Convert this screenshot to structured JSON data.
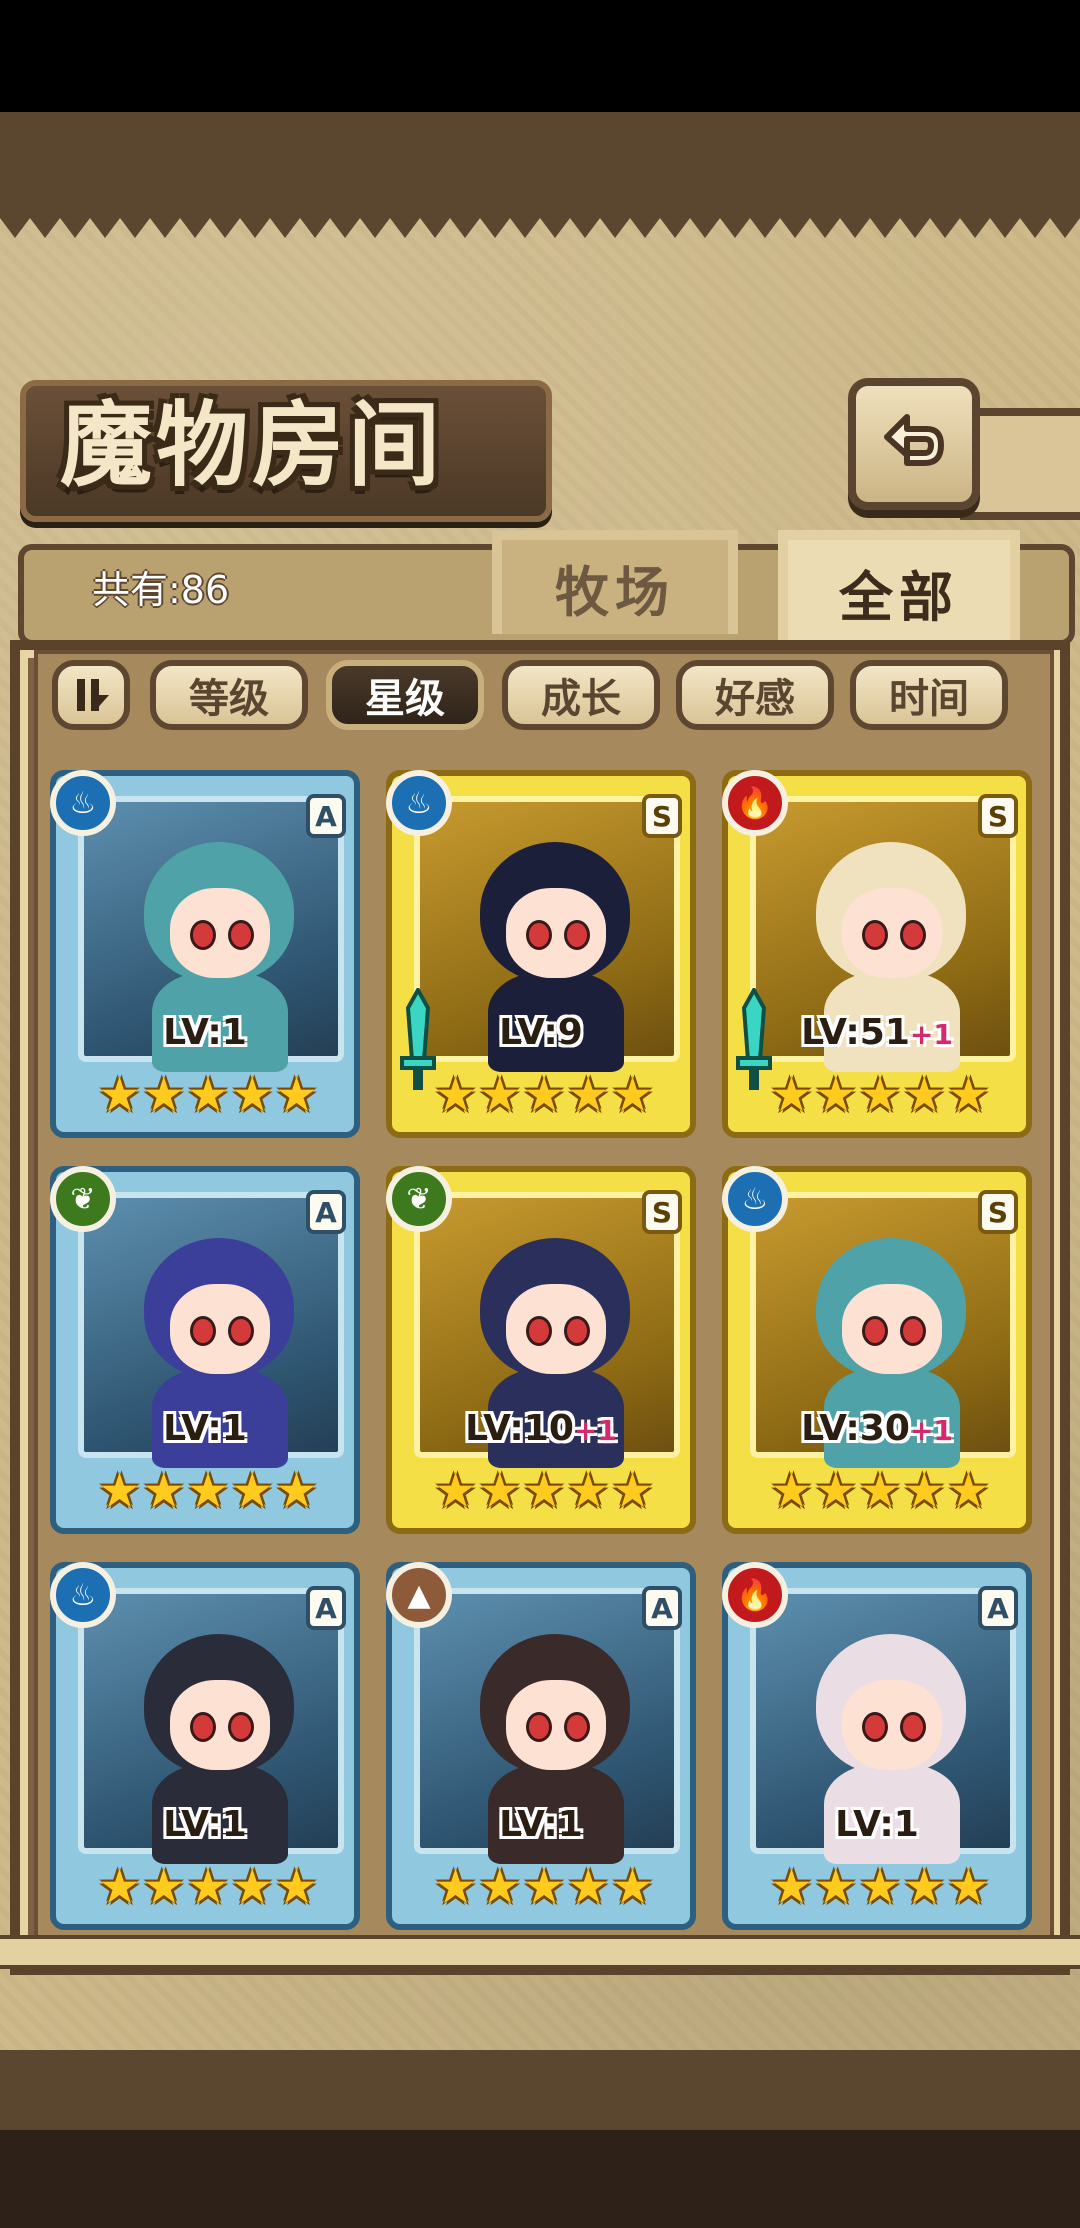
{
  "screen": {
    "title": "魔物房间",
    "count_label": "共有:86",
    "tabs": [
      {
        "label": "牧场",
        "active": false
      },
      {
        "label": "全部",
        "active": true
      }
    ],
    "sort_buttons": [
      {
        "label": "等级",
        "active": false
      },
      {
        "label": "星级",
        "active": true
      },
      {
        "label": "成长",
        "active": false
      },
      {
        "label": "好感",
        "active": false
      },
      {
        "label": "时间",
        "active": false
      }
    ],
    "icons": {
      "back": "back-arrow-icon",
      "sort_order": "sort-order-icon"
    }
  },
  "cards": [
    {
      "element": "water",
      "element_glyph": "♨",
      "rank": "A",
      "frame": "blue",
      "level": "LV:1",
      "plus": "",
      "stars": 5,
      "equipped": false,
      "hair": "#4fa3a8"
    },
    {
      "element": "water",
      "element_glyph": "♨",
      "rank": "S",
      "frame": "gold",
      "level": "LV:9",
      "plus": "",
      "stars": 5,
      "equipped": true,
      "hair": "#1c1f3a"
    },
    {
      "element": "fire",
      "element_glyph": "🔥",
      "rank": "S",
      "frame": "gold",
      "level": "LV:51",
      "plus": "+1",
      "stars": 5,
      "equipped": true,
      "hair": "#f1e2bf"
    },
    {
      "element": "grass",
      "element_glyph": "❦",
      "rank": "A",
      "frame": "blue",
      "level": "LV:1",
      "plus": "",
      "stars": 5,
      "equipped": false,
      "hair": "#3b3f9a"
    },
    {
      "element": "grass",
      "element_glyph": "❦",
      "rank": "S",
      "frame": "gold",
      "level": "LV:10",
      "plus": "+1",
      "stars": 5,
      "equipped": false,
      "hair": "#2b2f5c"
    },
    {
      "element": "water",
      "element_glyph": "♨",
      "rank": "S",
      "frame": "gold",
      "level": "LV:30",
      "plus": "+1",
      "stars": 5,
      "equipped": false,
      "hair": "#4fa3a8"
    },
    {
      "element": "water",
      "element_glyph": "♨",
      "rank": "A",
      "frame": "blue",
      "level": "LV:1",
      "plus": "",
      "stars": 5,
      "equipped": false,
      "hair": "#2a2c3a"
    },
    {
      "element": "earth",
      "element_glyph": "▲",
      "rank": "A",
      "frame": "blue",
      "level": "LV:1",
      "plus": "",
      "stars": 5,
      "equipped": false,
      "hair": "#3a2a2a"
    },
    {
      "element": "fire",
      "element_glyph": "🔥",
      "rank": "A",
      "frame": "blue",
      "level": "LV:1",
      "plus": "",
      "stars": 5,
      "equipped": false,
      "hair": "#eadde4"
    }
  ],
  "colors": {
    "blue_frame": "#8fc8df",
    "gold_frame": "#f4df47",
    "plus_text": "#d3296d",
    "star": "#ffcb1f"
  }
}
